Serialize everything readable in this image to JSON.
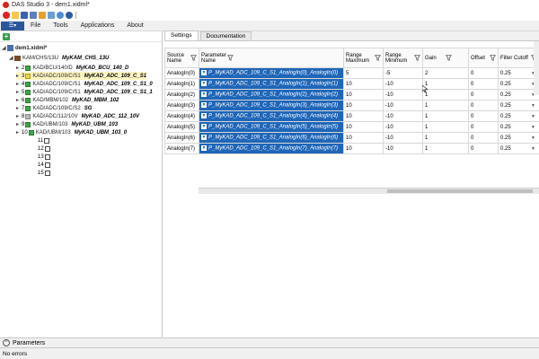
{
  "window": {
    "title": "DAS Studio 3 - dem1.xidml*"
  },
  "quick_access": [
    "save-icon",
    "open-icon",
    "disk-icon",
    "wand-icon",
    "table-icon",
    "link-icon",
    "help-icon"
  ],
  "menu": {
    "file": "File",
    "items": [
      "Tools",
      "Applications",
      "About"
    ]
  },
  "tree": {
    "root": "dem1.xidml*",
    "chassis": {
      "label": "KAM/CHS/13U",
      "name": "MyKAM_CHS_13U"
    },
    "slots": [
      {
        "num": "2",
        "label": "KAD/BCU/140/D",
        "name": "MyKAD_BCU_140_D",
        "color": "green",
        "selected": false
      },
      {
        "num": "3",
        "label": "KAD/ADC/109/C/S1",
        "name": "MyKAD_ADC_109_C_S1",
        "color": "yellow",
        "selected": true
      },
      {
        "num": "4",
        "label": "KAD/ADC/109/C/S1",
        "name": "MyKAD_ADC_109_C_S1_0",
        "color": "green",
        "selected": false
      },
      {
        "num": "5",
        "label": "KAD/ADC/109/C/S1",
        "name": "MyKAD_ADC_109_C_S1_1",
        "color": "green",
        "selected": false
      },
      {
        "num": "6",
        "label": "KAD/MBM/102",
        "name": "MyKAD_MBM_102",
        "color": "green",
        "selected": false
      },
      {
        "num": "7",
        "label": "KAD/ADC/109/C/S2",
        "name": "SG",
        "color": "green",
        "selected": false
      },
      {
        "num": "8",
        "label": "KAD/ADC/112/10V",
        "name": "MyKAD_ADC_112_10V",
        "color": "gray",
        "selected": false
      },
      {
        "num": "9",
        "label": "KAD/UBM/103",
        "name": "MyKAD_UBM_103",
        "color": "green",
        "selected": false
      },
      {
        "num": "10",
        "label": "KAD/UBM/103",
        "name": "MyKAD_UBM_103_0",
        "color": "green",
        "selected": false
      }
    ],
    "empty_slots": [
      "11",
      "12",
      "13",
      "14",
      "15"
    ]
  },
  "tabs": [
    {
      "label": "Settings",
      "active": true
    },
    {
      "label": "Documentation",
      "active": false
    }
  ],
  "grid": {
    "headers": {
      "source": "Source Name",
      "parameter": "Parameter Name",
      "range_max": "Range Maximum",
      "range_min": "Range Minimum",
      "gain": "Gain",
      "offset": "Offset",
      "filter": "Filter Cutoff"
    },
    "rows": [
      {
        "source": "AnalogIn(0)",
        "parameter": "P_MyKAD_ADC_109_C_S1_AnalogIn(0)_AnalogIn(0)",
        "range_max": "5",
        "range_min": "-5",
        "gain": "2",
        "offset": "0",
        "filter": "0.25"
      },
      {
        "source": "AnalogIn(1)",
        "parameter": "P_MyKAD_ADC_109_C_S1_AnalogIn(1)_AnalogIn(1)",
        "range_max": "10",
        "range_min": "-10",
        "gain": "1",
        "offset": "0",
        "filter": "0.25"
      },
      {
        "source": "AnalogIn(2)",
        "parameter": "P_MyKAD_ADC_109_C_S1_AnalogIn(2)_AnalogIn(2)",
        "range_max": "10",
        "range_min": "-10",
        "gain": "1",
        "offset": "0",
        "filter": "0.25"
      },
      {
        "source": "AnalogIn(3)",
        "parameter": "P_MyKAD_ADC_109_C_S1_AnalogIn(3)_AnalogIn(3)",
        "range_max": "10",
        "range_min": "-10",
        "gain": "1",
        "offset": "0",
        "filter": "0.25"
      },
      {
        "source": "AnalogIn(4)",
        "parameter": "P_MyKAD_ADC_109_C_S1_AnalogIn(4)_AnalogIn(4)",
        "range_max": "10",
        "range_min": "-10",
        "gain": "1",
        "offset": "0",
        "filter": "0.25"
      },
      {
        "source": "AnalogIn(5)",
        "parameter": "P_MyKAD_ADC_109_C_S1_AnalogIn(5)_AnalogIn(5)",
        "range_max": "10",
        "range_min": "-10",
        "gain": "1",
        "offset": "0",
        "filter": "0.25"
      },
      {
        "source": "AnalogIn(6)",
        "parameter": "P_MyKAD_ADC_109_C_S1_AnalogIn(6)_AnalogIn(6)",
        "range_max": "10",
        "range_min": "-10",
        "gain": "1",
        "offset": "0",
        "filter": "0.25"
      },
      {
        "source": "AnalogIn(7)",
        "parameter": "P_MyKAD_ADC_109_C_S1_AnalogIn(7)_AnalogIn(7)",
        "range_max": "10",
        "range_min": "-10",
        "gain": "1",
        "offset": "0",
        "filter": "0.25"
      }
    ]
  },
  "bottom_panel": {
    "label": "Parameters"
  },
  "status": {
    "text": "No errors"
  },
  "colors": {
    "accent": "#1f66b8",
    "file_button": "#2b579a",
    "selected_slot": "#fdf6c4",
    "slot_ok": "#3aa84a"
  }
}
